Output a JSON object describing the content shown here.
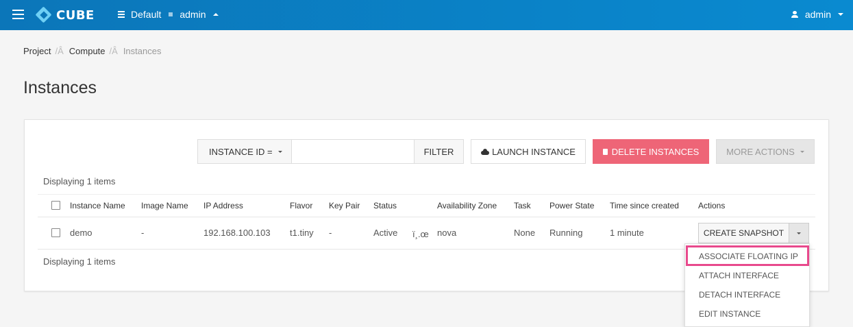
{
  "topbar": {
    "brand": "CUBE",
    "domain": "Default",
    "project": "admin",
    "user": "admin"
  },
  "breadcrumb": {
    "items": [
      "Project",
      "Compute",
      "Instances"
    ],
    "separator": "/Â"
  },
  "page": {
    "title": "Instances"
  },
  "toolbar": {
    "filter_field": "INSTANCE ID =",
    "filter_value": "",
    "filter_label": "FILTER",
    "launch_label": "LAUNCH INSTANCE",
    "delete_label": "DELETE INSTANCES",
    "more_label": "MORE ACTIONS"
  },
  "table": {
    "count_text": "Displaying 1 items",
    "columns": [
      "Instance Name",
      "Image Name",
      "IP Address",
      "Flavor",
      "Key Pair",
      "Status",
      "Availability Zone",
      "Task",
      "Power State",
      "Time since created",
      "Actions"
    ],
    "rows": [
      {
        "name": "demo",
        "image": "-",
        "ip": "192.168.100.103",
        "flavor": "t1.tiny",
        "key_pair": "-",
        "status": "Active",
        "status_glyph": "ï¸.œ",
        "zone": "nova",
        "task": "None",
        "power": "Running",
        "age": "1 minute",
        "action": "CREATE SNAPSHOT"
      }
    ]
  },
  "actions_menu": {
    "items": [
      "ASSOCIATE FLOATING IP",
      "ATTACH INTERFACE",
      "DETACH INTERFACE",
      "EDIT INSTANCE"
    ],
    "highlighted": "ASSOCIATE FLOATING IP"
  },
  "colors": {
    "header": "#0b76b9",
    "danger": "#ee6577",
    "link": "#2b6fa8",
    "highlight": "#e8498c"
  }
}
